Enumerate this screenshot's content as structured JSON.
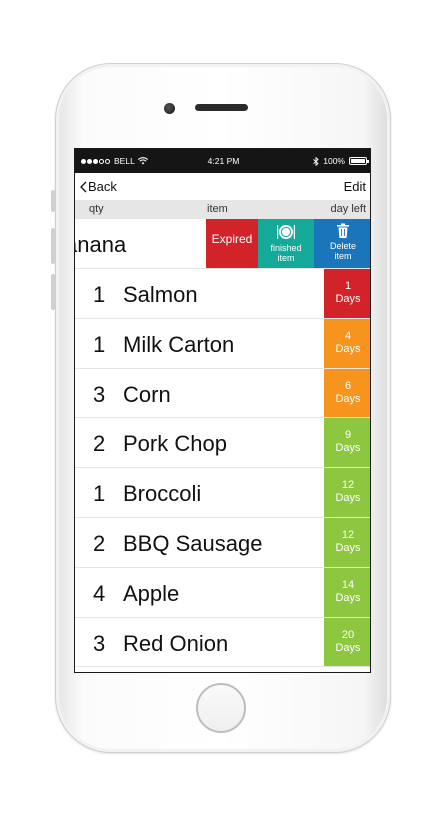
{
  "status_bar": {
    "carrier": "BELL",
    "time": "4:21 PM",
    "battery": "100%",
    "icons": [
      "signal-dots-icon",
      "wifi-icon",
      "bluetooth-icon",
      "battery-icon"
    ]
  },
  "nav": {
    "back_label": "Back",
    "edit_label": "Edit"
  },
  "columns": {
    "qty": "qty",
    "item": "item",
    "days_left": "day left"
  },
  "swiped_row": {
    "name": "Banana",
    "visible_text": "anana",
    "actions": {
      "expired": "Expired",
      "finished_line1": "finished",
      "finished_line2": "item",
      "delete_line1": "Delete",
      "delete_line2": "item"
    }
  },
  "items": [
    {
      "qty": "1",
      "name": "Salmon",
      "days": "1",
      "unit": "Days",
      "color": "#d2232a"
    },
    {
      "qty": "1",
      "name": "Milk Carton",
      "days": "4",
      "unit": "Days",
      "color": "#f7941d"
    },
    {
      "qty": "3",
      "name": "Corn",
      "days": "6",
      "unit": "Days",
      "color": "#f7941d"
    },
    {
      "qty": "2",
      "name": "Pork Chop",
      "days": "9",
      "unit": "Days",
      "color": "#8dc63f"
    },
    {
      "qty": "1",
      "name": "Broccoli",
      "days": "12",
      "unit": "Days",
      "color": "#8dc63f"
    },
    {
      "qty": "2",
      "name": "BBQ Sausage",
      "days": "12",
      "unit": "Days",
      "color": "#8dc63f"
    },
    {
      "qty": "4",
      "name": "Apple",
      "days": "14",
      "unit": "Days",
      "color": "#8dc63f"
    },
    {
      "qty": "3",
      "name": "Red Onion",
      "days": "20",
      "unit": "Days",
      "color": "#8dc63f"
    }
  ]
}
